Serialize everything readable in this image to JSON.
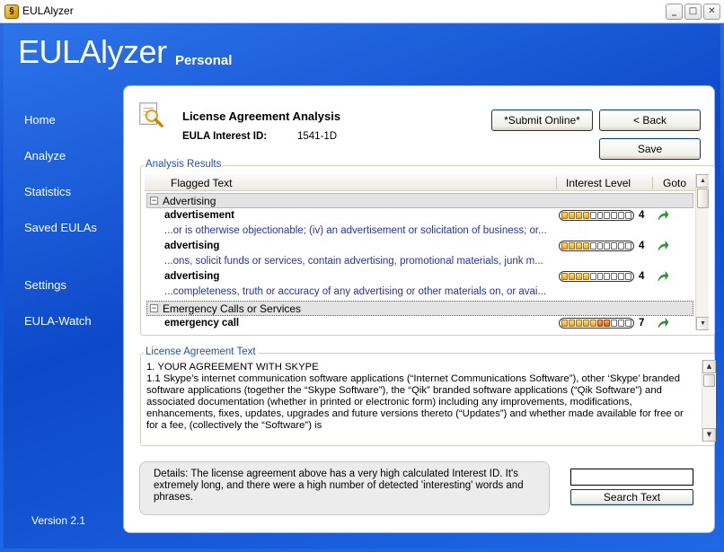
{
  "window": {
    "title": "EULAlyzer",
    "minimize": "_",
    "maximize": "□",
    "close": "✕"
  },
  "brand": {
    "name": "EULAlyzer",
    "edition": "Personal",
    "version": "Version 2.1"
  },
  "sidebar": {
    "items": [
      {
        "label": "Home"
      },
      {
        "label": "Analyze"
      },
      {
        "label": "Statistics"
      },
      {
        "label": "Saved EULAs"
      },
      {
        "label": "Settings"
      },
      {
        "label": "EULA-Watch"
      }
    ]
  },
  "page": {
    "title": "License Agreement Analysis",
    "interest_id_label": "EULA Interest ID:",
    "interest_id_value": "1541-1D",
    "icon": "magnifier-document-icon"
  },
  "buttons": {
    "submit_online": "*Submit Online*",
    "back": "< Back",
    "save": "Save",
    "search_text": "Search Text"
  },
  "analysis": {
    "group_label": "Analysis Results",
    "columns": {
      "flagged_text": "Flagged Text",
      "interest_level": "Interest Level",
      "goto": "Goto"
    },
    "groups": [
      {
        "name": "Advertising",
        "expander": "−",
        "items": [
          {
            "word": "advertisement",
            "context": "...or is otherwise objectionable; (iv) an advertisement or solicitation of business; or...",
            "level": 4
          },
          {
            "word": "advertising",
            "context": "...ons, solicit funds or services, contain advertising, promotional materials, junk m...",
            "level": 4
          },
          {
            "word": "advertising",
            "context": "...completeness, truth or accuracy of any advertising or other materials on, or avai...",
            "level": 4
          }
        ]
      },
      {
        "name": "Emergency Calls or Services",
        "expander": "−",
        "items": [
          {
            "word": "emergency call",
            "context": "",
            "level": 7
          }
        ]
      }
    ],
    "max_level": 10,
    "goto_icon": "green-arrow-icon"
  },
  "license": {
    "group_label": "License Agreement Text",
    "text": "1. YOUR AGREEMENT WITH SKYPE\n1.1 Skype’s internet communication software applications (“Internet Communications Software”), other ‘Skype’ branded software applications (together the “Skype Software”), the “Qik” branded software applications (“Qik Software”) and associated documentation (whether in printed or electronic form) including any improvements, modifications, enhancements, fixes, updates, upgrades and future versions thereto (“Updates”) and whether made available for free or for a fee, (collectively the “Software”) is"
  },
  "details": {
    "text": "Details: The license agreement above has a very high calculated Interest ID. It's extremely long, and there were a high number of detected 'interesting' words and phrases."
  },
  "search": {
    "value": ""
  },
  "colors": {
    "accent_blue": "#0b4ed6",
    "group_label": "#2150b9",
    "context_text": "#2433aa",
    "meter_on": "#f0a414",
    "meter_high": "#e35a00",
    "goto_green": "#2aa52a"
  }
}
